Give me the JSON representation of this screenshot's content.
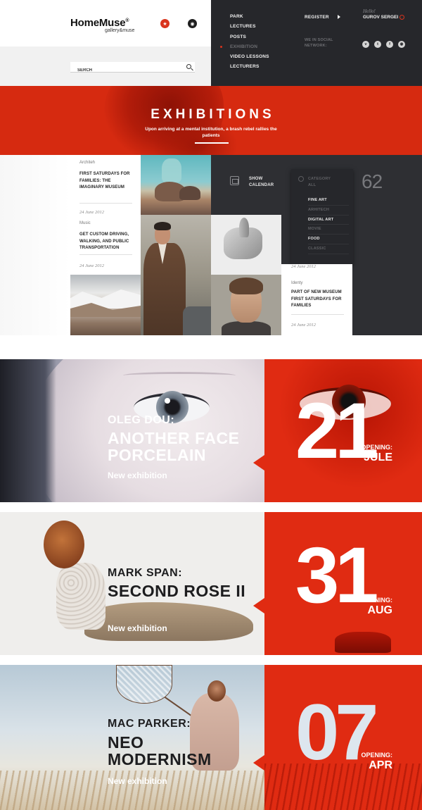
{
  "header": {
    "logo": "HomeMuse",
    "logo_mark": "®",
    "logo_sub": "gallery&muse",
    "search_placeholder": "SERCH",
    "nav": [
      "PARK",
      "LECTURES",
      "POSTS",
      "EXHIBITION",
      "VIDEO LESSONS",
      "LECTURERS"
    ],
    "nav_active": "EXHIBITION",
    "register": "REGISTER",
    "hello": "Hello!",
    "username": "GUROV SERGEI",
    "social_label": "WE IN SOCIAL NETWORK:",
    "social_icons": [
      "vimeo-icon",
      "twitter-icon",
      "facebook-icon",
      "rss-icon"
    ]
  },
  "banner": {
    "title": "EXHIBITIONS",
    "subtitle": "Upon arriving at a mental institution, a brash rebel rallies the patients"
  },
  "posts": [
    {
      "category": "Architeh",
      "title": "FIRST SATURDAYS FOR FAMILIES: THE IMAGINARY MUSEUM",
      "date": "24 June 2012"
    },
    {
      "category": "Music",
      "title": "GET CUSTOM DRIVING, WALKING, AND PUBLIC TRANSPORTATION",
      "date": "24 June 2012"
    },
    {
      "category": "Identy",
      "title": "PART OF NEW MUSEUM FIRST SATURDAYS FOR FAMILIES",
      "date": "24 June 2012",
      "date_top": "24 June 2012"
    }
  ],
  "calendar": {
    "label": "SHOW CALENDAR"
  },
  "counter": "62",
  "category": {
    "label": "CATEGORY ALL",
    "items": [
      {
        "name": "FINE ART",
        "active": true
      },
      {
        "name": "ARHITECH",
        "active": false
      },
      {
        "name": "DIGITAL ART",
        "active": true
      },
      {
        "name": "MOVIE",
        "active": false
      },
      {
        "name": "FOOD",
        "active": true
      },
      {
        "name": "CLASSIC",
        "active": false
      }
    ]
  },
  "exhibitions": [
    {
      "artist": "OLEG DOU:",
      "title_line1": "ANOTHER FACE",
      "title_line2": "PORCELAIN",
      "subtitle": "New exhibition",
      "day": "21",
      "opening": "OPENING:",
      "month": "JULE"
    },
    {
      "artist": "MARK SPAN:",
      "title_line1": "SECOND ROSE II",
      "title_line2": "",
      "subtitle": "New exhibition",
      "day": "31",
      "opening": "OPENING:",
      "month": "AUG"
    },
    {
      "artist": "MAC PARKER:",
      "title_line1": "NEO",
      "title_line2": "MODERNISM",
      "subtitle": "New exhibition",
      "day": "07",
      "opening": "OPENING:",
      "month": "APR"
    }
  ],
  "colors": {
    "accent": "#e02b12",
    "dark": "#26272b",
    "light": "#f1f1f1"
  }
}
